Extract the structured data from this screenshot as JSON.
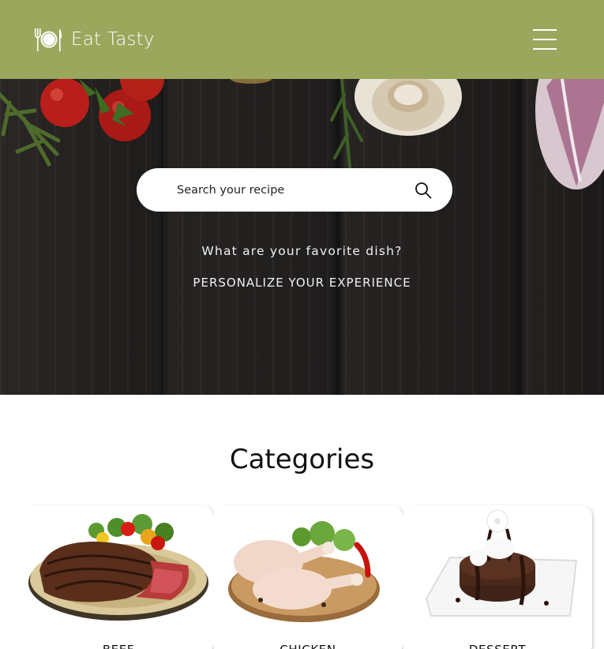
{
  "header": {
    "brand": "Eat Tasty",
    "logo_icon": "plate-utensils-icon",
    "menu_icon": "hamburger-menu-icon",
    "background_color": "#9aa75c"
  },
  "hero": {
    "search": {
      "placeholder": "Search your recipe",
      "icon": "search-icon"
    },
    "question": "What are your favorite dish?",
    "cta": "PERSONALIZE YOUR EXPERIENCE"
  },
  "categories": {
    "title": "Categories",
    "items": [
      {
        "label": "BEEF"
      },
      {
        "label": "CHICKEN"
      },
      {
        "label": "DESSERT"
      }
    ]
  }
}
